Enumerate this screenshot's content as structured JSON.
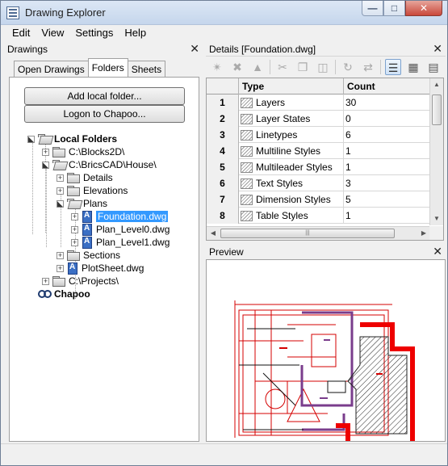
{
  "window": {
    "title": "Drawing Explorer"
  },
  "menu": [
    "Edit",
    "View",
    "Settings",
    "Help"
  ],
  "left_panel": {
    "title": "Drawings",
    "tabs": [
      {
        "label": "Open Drawings",
        "active": false
      },
      {
        "label": "Folders",
        "active": true
      },
      {
        "label": "Sheets",
        "active": false
      }
    ],
    "buttons": {
      "add_folder": "Add local folder...",
      "logon": "Logon to Chapoo..."
    },
    "tree": {
      "local_folders": "Local Folders",
      "blocks2d": "C:\\Blocks2D\\",
      "house": "C:\\BricsCAD\\House\\",
      "details": "Details",
      "elevations": "Elevations",
      "plans": "Plans",
      "foundation": "Foundation.dwg",
      "plan_level0": "Plan_Level0.dwg",
      "plan_level1": "Plan_Level1.dwg",
      "sections": "Sections",
      "plotsheet": "PlotSheet.dwg",
      "projects": "C:\\Projects\\",
      "chapoo": "Chapoo"
    }
  },
  "details_panel": {
    "title": "Details [Foundation.dwg]",
    "columns": [
      "Type",
      "Count"
    ],
    "rows": [
      {
        "num": "1",
        "type": "Layers",
        "count": "30"
      },
      {
        "num": "2",
        "type": "Layer States",
        "count": "0"
      },
      {
        "num": "3",
        "type": "Linetypes",
        "count": "6"
      },
      {
        "num": "4",
        "type": "Multiline Styles",
        "count": "1"
      },
      {
        "num": "5",
        "type": "Multileader Styles",
        "count": "1"
      },
      {
        "num": "6",
        "type": "Text Styles",
        "count": "3"
      },
      {
        "num": "7",
        "type": "Dimension Styles",
        "count": "5"
      },
      {
        "num": "8",
        "type": "Table Styles",
        "count": "1"
      }
    ]
  },
  "preview_panel": {
    "title": "Preview"
  }
}
